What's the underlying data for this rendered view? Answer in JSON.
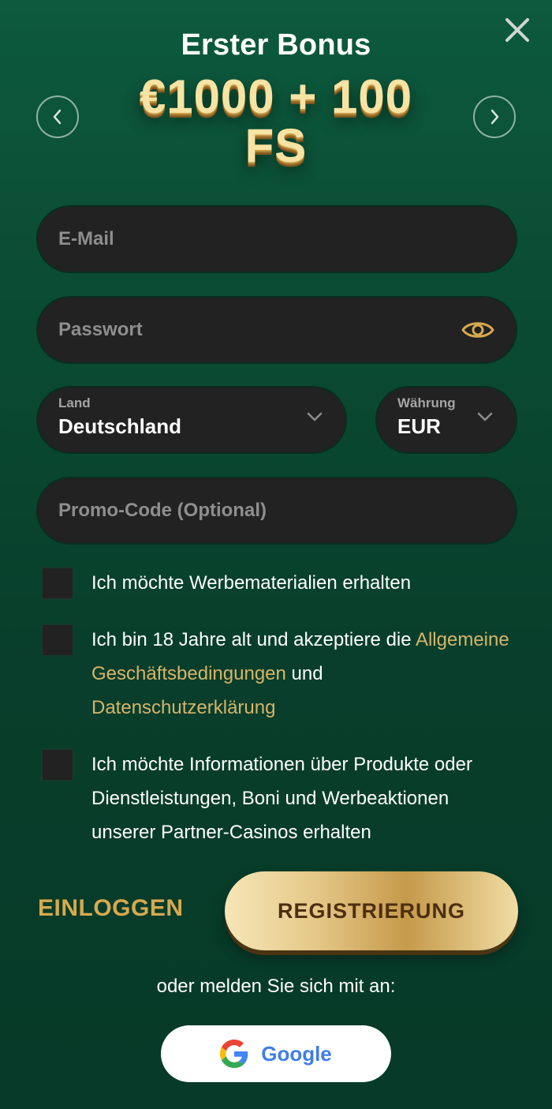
{
  "header": {
    "title": "Erster Bonus",
    "bonus": "€1000 + 100 FS"
  },
  "form": {
    "email_placeholder": "E-Mail",
    "password_placeholder": "Passwort",
    "country": {
      "label": "Land",
      "value": "Deutschland"
    },
    "currency": {
      "label": "Währung",
      "value": "EUR"
    },
    "promo_placeholder": "Promo-Code (Optional)"
  },
  "checkboxes": {
    "marketing": "Ich möchte Werbematerialien erhalten",
    "terms_prefix": "Ich bin 18 Jahre alt und akzeptiere die",
    "terms_link": "Allgemeine Geschäftsbedingungen",
    "terms_and": "und",
    "privacy_link": "Datenschutzerklärung",
    "partners": "Ich möchte Informationen über Produkte oder Dienstleistungen, Boni und Werbeaktionen unserer Partner-Casinos erhalten"
  },
  "actions": {
    "login": "EINLOGGEN",
    "register": "REGISTRIERUNG",
    "or_text": "oder melden Sie sich mit an:",
    "google": "Google"
  },
  "colors": {
    "accent_gold": "#d7b46a",
    "background_green": "#0a4b33",
    "field_bg": "#222223"
  }
}
